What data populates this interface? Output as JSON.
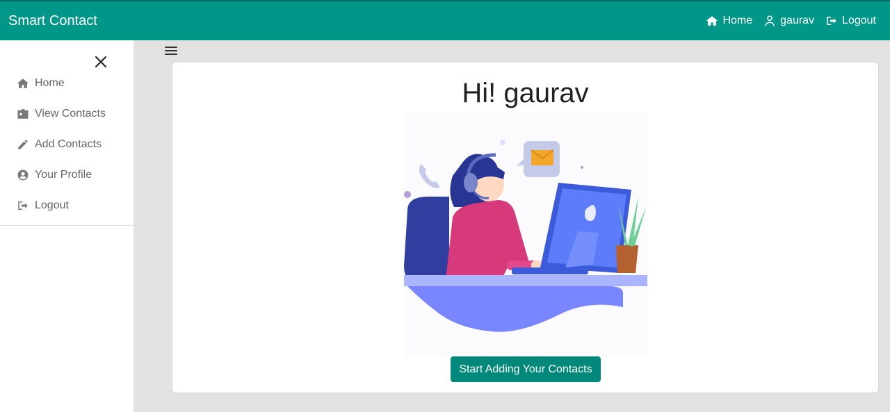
{
  "navbar": {
    "brand": "Smart Contact",
    "links": [
      {
        "label": "Home",
        "icon": "home-icon"
      },
      {
        "label": "gaurav",
        "icon": "user-icon"
      },
      {
        "label": "Logout",
        "icon": "sign-out-icon"
      }
    ]
  },
  "sidebar": {
    "items": [
      {
        "label": "Home",
        "icon": "home-icon"
      },
      {
        "label": "View Contacts",
        "icon": "id-card-icon"
      },
      {
        "label": "Add Contacts",
        "icon": "pencil-icon"
      },
      {
        "label": "Your Profile",
        "icon": "user-circle-icon"
      },
      {
        "label": "Logout",
        "icon": "sign-out-icon"
      }
    ]
  },
  "main": {
    "greeting": "Hi! gaurav",
    "cta_label": "Start Adding Your Contacts"
  },
  "colors": {
    "primary": "#009688",
    "button": "#00897b"
  }
}
